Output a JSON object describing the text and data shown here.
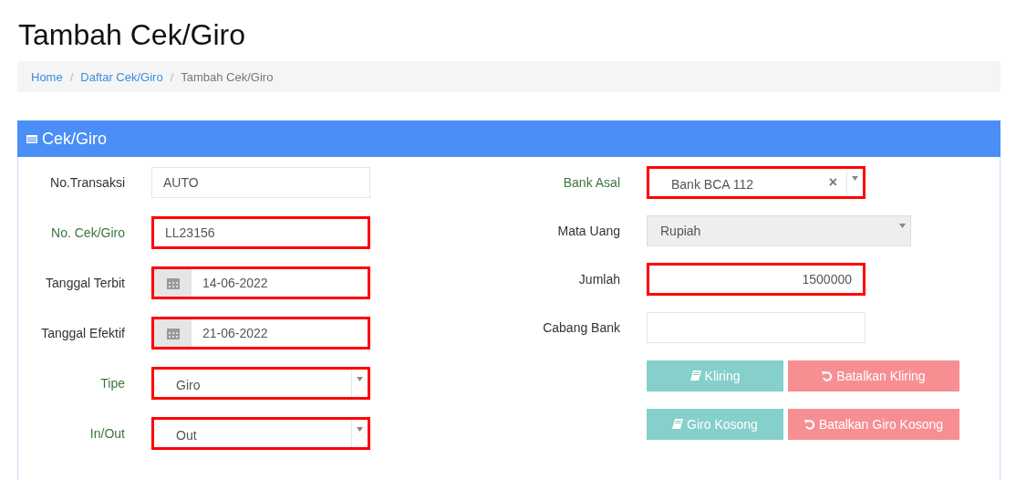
{
  "page_title": "Tambah Cek/Giro",
  "breadcrumb": [
    {
      "label": "Home",
      "current": false
    },
    {
      "separator": "/",
      "label": "Daftar Cek/Giro",
      "current": false
    },
    {
      "separator": "/",
      "label": "Tambah Cek/Giro",
      "current": true
    }
  ],
  "panel": {
    "title": "Cek/Giro"
  },
  "left_fields": [
    {
      "label": "No.Transaksi",
      "kind": "text",
      "value": "AUTO",
      "success": false,
      "highlighted": false
    },
    {
      "label": "No. Cek/Giro",
      "kind": "text",
      "value": "LL23156",
      "success": true,
      "highlighted": true
    },
    {
      "label": "Tanggal Terbit",
      "kind": "date",
      "value": "14-06-2022",
      "success": false,
      "highlighted": true
    },
    {
      "label": "Tanggal Efektif",
      "kind": "date",
      "value": "21-06-2022",
      "success": false,
      "highlighted": true
    },
    {
      "label": "Tipe",
      "kind": "select",
      "value": "Giro",
      "success": true,
      "highlighted": true
    },
    {
      "label": "In/Out",
      "kind": "select",
      "value": "Out",
      "success": true,
      "highlighted": true
    }
  ],
  "right_fields": [
    {
      "label": "Bank Asal",
      "kind": "select",
      "value": "Bank BCA 112",
      "success": true,
      "highlighted": true,
      "clear_icon": "×"
    },
    {
      "label": "Mata Uang",
      "kind": "select",
      "value": "Rupiah",
      "success": false,
      "highlighted": false,
      "disabled": true
    },
    {
      "label": "Jumlah",
      "kind": "text",
      "value": "1500000",
      "success": false,
      "highlighted": true,
      "numeric": true
    },
    {
      "label": "Cabang Bank",
      "kind": "text",
      "success": false,
      "highlighted": false
    }
  ],
  "button_rows": [
    [
      {
        "label": "Kliring",
        "kind": "action"
      },
      {
        "label": "Batalkan Kliring",
        "kind": "cancel"
      }
    ],
    [
      {
        "label": "Giro Kosong",
        "kind": "action"
      },
      {
        "label": "Batalkan Giro Kosong",
        "kind": "cancel"
      }
    ]
  ]
}
